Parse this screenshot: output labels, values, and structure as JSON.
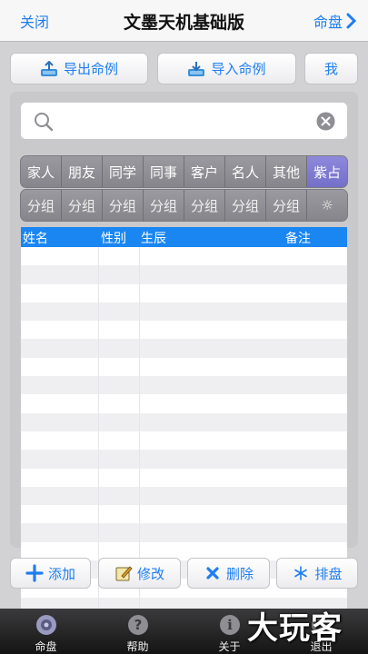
{
  "navbar": {
    "left": "关闭",
    "title": "文墨天机基础版",
    "right": "命盘"
  },
  "top_buttons": {
    "export": "导出命例",
    "import": "导入命例",
    "me": "我"
  },
  "search": {
    "value": "",
    "placeholder": ""
  },
  "categories": [
    "家人",
    "朋友",
    "同学",
    "同事",
    "客户",
    "名人",
    "其他",
    "紫占"
  ],
  "selected_category": "紫占",
  "groups": [
    "分组",
    "分组",
    "分组",
    "分组",
    "分组",
    "分组",
    "分组",
    "☼"
  ],
  "table": {
    "headers": [
      "姓名",
      "性别",
      "生辰",
      "备注"
    ],
    "row_count": 21
  },
  "actions": {
    "add": "添加",
    "edit": "修改",
    "delete": "删除",
    "chart": "排盘"
  },
  "tabbar": [
    "命盘",
    "帮助",
    "关于",
    "退出"
  ],
  "watermark": "大玩客",
  "colors": {
    "accent": "#1f7ef0",
    "header": "#1a86f2",
    "selected_segment": "#7f7ad2"
  }
}
